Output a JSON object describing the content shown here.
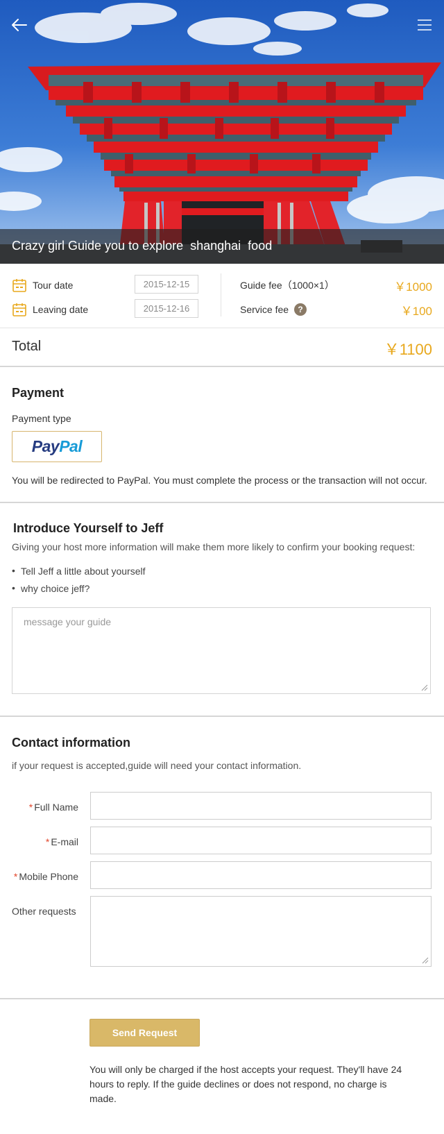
{
  "hero": {
    "title": "Crazy girl Guide you to explore  shanghai  food",
    "back_icon": "arrow-left-icon",
    "menu_icon": "hamburger-menu-icon"
  },
  "summary": {
    "tour_date_label": "Tour date",
    "tour_date_value": "2015-12-15",
    "leaving_date_label": "Leaving date",
    "leaving_date_value": "2015-12-16",
    "guide_fee_label": "Guide fee（1000×1）",
    "guide_fee_value": "￥1000",
    "service_fee_label": "Service fee",
    "service_fee_help": "?",
    "service_fee_value": "￥100",
    "total_label": "Total",
    "total_value": "￥1100"
  },
  "payment": {
    "title": "Payment",
    "type_label": "Payment type",
    "paypal_pay": "Pay",
    "paypal_pal": "Pal",
    "redirect_note": "You will be redirected to PayPal. You must complete the process or the transaction will not occur."
  },
  "introduce": {
    "title": "Introduce Yourself to Jeff",
    "description": "Giving your host more information will make them more likely to confirm your booking request:",
    "bullets": [
      "Tell Jeff a little about yourself",
      "why choice jeff?"
    ],
    "message_placeholder": "message your guide"
  },
  "contact": {
    "title": "Contact information",
    "description": "if your request is accepted,guide will need your contact information.",
    "required_mark": "*",
    "full_name_label": "Full Name",
    "email_label": "E-mail",
    "mobile_label": "Mobile Phone",
    "other_label": "Other requests"
  },
  "submit": {
    "send_label": "Send Request",
    "charge_note": "You will only be charged if the host accepts your request. They'll have 24 hours to reply. If the guide declines or does not respond, no charge is made."
  },
  "colors": {
    "accent_gold": "#e8a81d",
    "button_gold": "#d9b868",
    "pavilion_red": "#e01b1f",
    "required_red": "#e2462b"
  }
}
